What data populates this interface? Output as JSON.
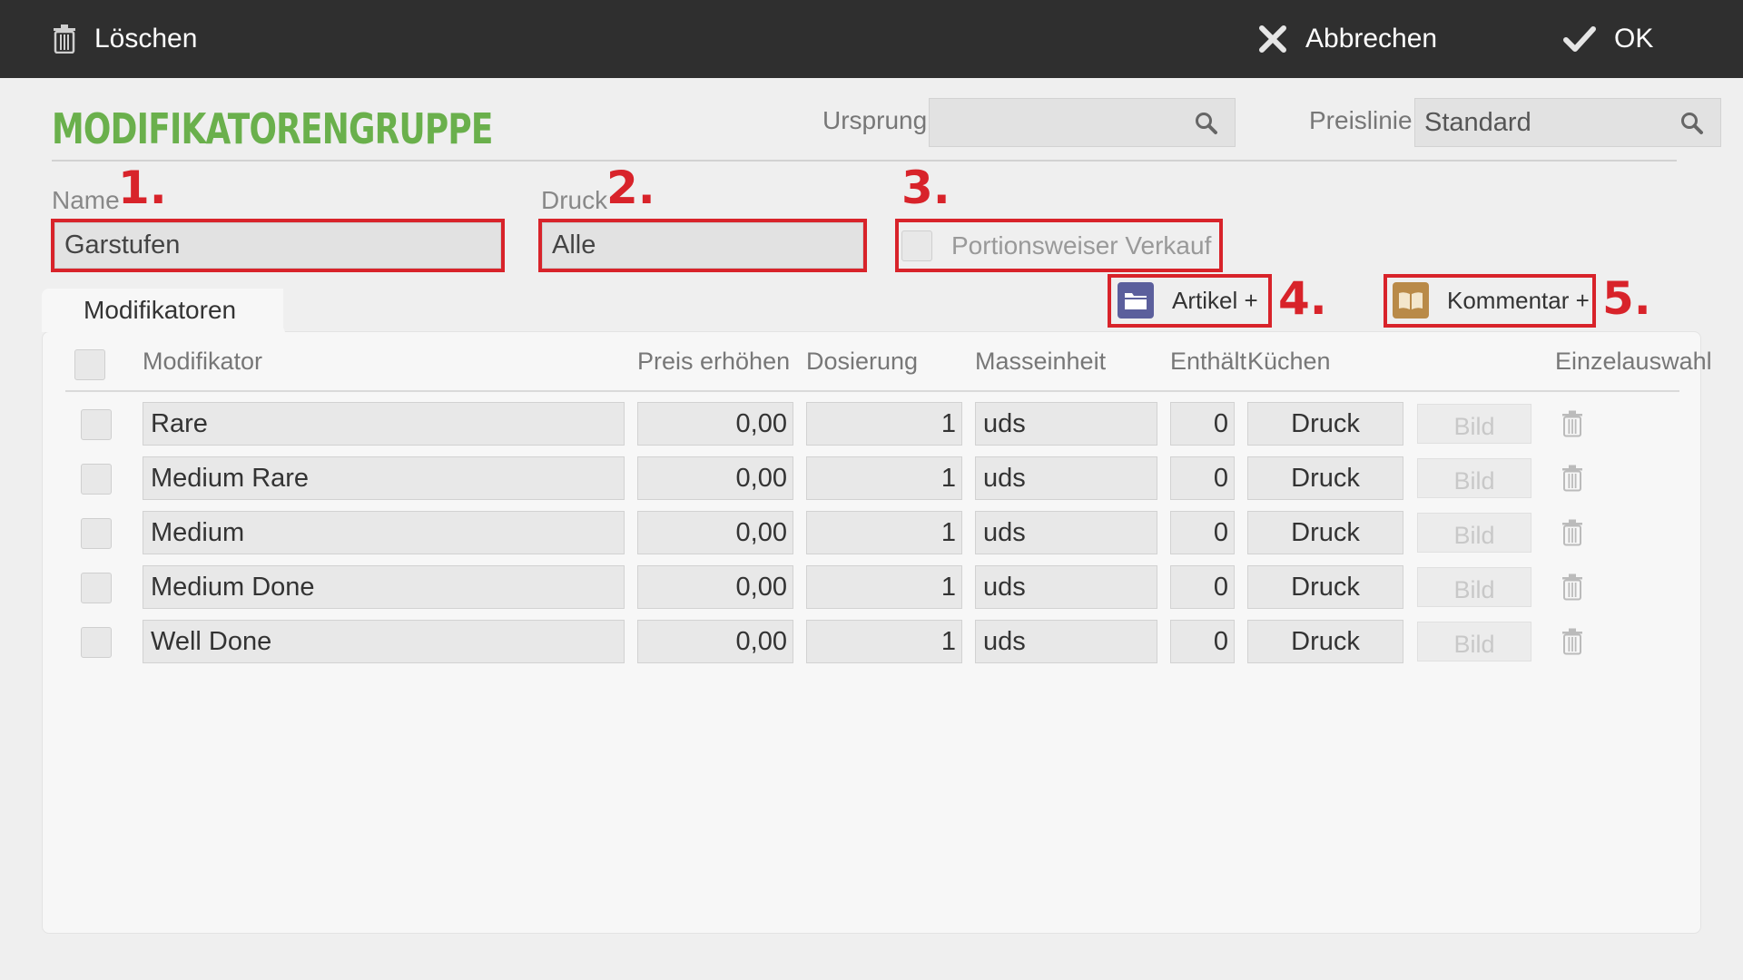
{
  "toolbar": {
    "delete_label": "Löschen",
    "cancel_label": "Abbrechen",
    "ok_label": "OK"
  },
  "header": {
    "title": "MODIFIKATORENGRUPPE",
    "origin_label": "Ursprung",
    "origin_value": "",
    "priceline_label": "Preislinie",
    "priceline_value": "Standard"
  },
  "form": {
    "name_label": "Name",
    "name_value": "Garstufen",
    "print_label": "Druck",
    "print_value": "Alle",
    "portion_label": "Portionsweiser Verkauf",
    "portion_checked": false
  },
  "annotations": [
    "1.",
    "2.",
    "3.",
    "4.",
    "5."
  ],
  "tabs": [
    {
      "label": "Modifikatoren"
    }
  ],
  "actions": {
    "article_add_label": "Artikel +",
    "comment_add_label": "Kommentar +"
  },
  "table": {
    "columns": [
      "Modifikator",
      "Preis erhöhen",
      "Dosierung",
      "Masseinheit",
      "Enthält",
      "Küchen",
      "Einzelauswahl"
    ],
    "rows": [
      {
        "name": "Rare",
        "price": "0,00",
        "dose": "1",
        "unit": "uds",
        "contains": "0",
        "kitchen": "Druck",
        "image": "Bild"
      },
      {
        "name": "Medium Rare",
        "price": "0,00",
        "dose": "1",
        "unit": "uds",
        "contains": "0",
        "kitchen": "Druck",
        "image": "Bild"
      },
      {
        "name": "Medium",
        "price": "0,00",
        "dose": "1",
        "unit": "uds",
        "contains": "0",
        "kitchen": "Druck",
        "image": "Bild"
      },
      {
        "name": "Medium Done",
        "price": "0,00",
        "dose": "1",
        "unit": "uds",
        "contains": "0",
        "kitchen": "Druck",
        "image": "Bild"
      },
      {
        "name": "Well Done",
        "price": "0,00",
        "dose": "1",
        "unit": "uds",
        "contains": "0",
        "kitchen": "Druck",
        "image": "Bild"
      }
    ]
  },
  "colors": {
    "topbar": "#2f2f2f",
    "title": "#6ab04c",
    "annotation": "#d8232a",
    "article_icon": "#5b5f9c",
    "comment_icon": "#b98a48"
  }
}
